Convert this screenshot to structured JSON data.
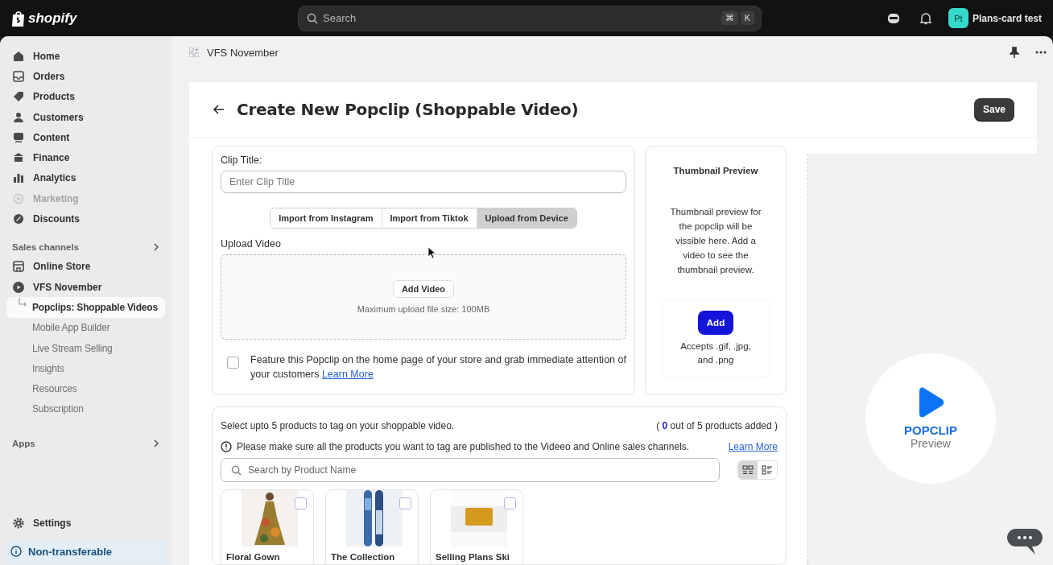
{
  "topbar": {
    "logo": "shopify",
    "search": {
      "placeholder": "Search",
      "shortcut": [
        "⌘",
        "K"
      ]
    },
    "account": {
      "initials": "Pt",
      "name": "Plans-card test"
    }
  },
  "sidebar": {
    "items": [
      {
        "label": "Home",
        "selected": false,
        "disabled": false
      },
      {
        "label": "Orders",
        "selected": false,
        "disabled": false
      },
      {
        "label": "Products",
        "selected": false,
        "disabled": false
      },
      {
        "label": "Customers",
        "selected": false,
        "disabled": false
      },
      {
        "label": "Content",
        "selected": false,
        "disabled": false
      },
      {
        "label": "Finance",
        "selected": false,
        "disabled": false
      },
      {
        "label": "Analytics",
        "selected": false,
        "disabled": false
      },
      {
        "label": "Marketing",
        "selected": false,
        "disabled": true
      },
      {
        "label": "Discounts",
        "selected": false,
        "disabled": false
      }
    ],
    "sales_channels": {
      "title": "Sales channels",
      "items": [
        {
          "label": "Online Store",
          "selected": false
        },
        {
          "label": "VFS November",
          "selected": false,
          "children": [
            {
              "label": "Popclips: Shoppable Videos",
              "selected": true
            },
            {
              "label": "Mobile App Builder",
              "selected": false
            },
            {
              "label": "Live Stream Selling",
              "selected": false
            },
            {
              "label": "Insights",
              "selected": false
            },
            {
              "label": "Resources",
              "selected": false
            },
            {
              "label": "Subscription",
              "selected": false
            }
          ]
        }
      ]
    },
    "apps": {
      "title": "Apps"
    },
    "settings": "Settings",
    "notice": "Non-transferable"
  },
  "breadcrumb": "VFS November",
  "page": {
    "title": "Create New Popclip (Shoppable Video)",
    "save": "Save"
  },
  "clip_form": {
    "title_label": "Clip Title:",
    "title_placeholder": "Enter Clip Title",
    "tabs": [
      {
        "label": "Import from Instagram",
        "selected": false
      },
      {
        "label": "Import from Tiktok",
        "selected": false
      },
      {
        "label": "Upload from Device",
        "selected": true
      }
    ],
    "upload_label": "Upload Video",
    "add_video": "Add Video",
    "max_size": "Maximum upload file size: 100MB",
    "feature": {
      "checked": false,
      "text": "Feature this Popclip on the home page of your store and grab immediate attention of your customers",
      "link": "Learn More"
    }
  },
  "thumbnail": {
    "title": "Thumbnail Preview",
    "text": "Thumbnail preview for the popclip will be vissible here. Add a video to see the thumbnail preview.",
    "add": "Add",
    "accepts": "Accepts .gif, .jpg, and .png"
  },
  "products": {
    "intro": "Select upto 5 products to tag on your shoppable video.",
    "count_open": "(",
    "count": "0",
    "count_rest": "out of 5 products added )",
    "notice": "Please make sure all the products you want to tag are published to the Videeo and Online sales channels.",
    "link": "Learn More",
    "search_placeholder": "Search by Product Name",
    "views": [
      {
        "kind": "grid",
        "selected": true
      },
      {
        "kind": "list",
        "selected": false
      }
    ],
    "items": [
      {
        "name": "Floral Gown",
        "kind": "picture",
        "checked": false
      },
      {
        "name": "The Collection",
        "kind": "picture",
        "checked": false
      },
      {
        "name": "Selling Plans Ski",
        "kind": "picture",
        "checked": false
      }
    ]
  },
  "preview": {
    "brand": "POPCLIP",
    "label": "Preview"
  }
}
